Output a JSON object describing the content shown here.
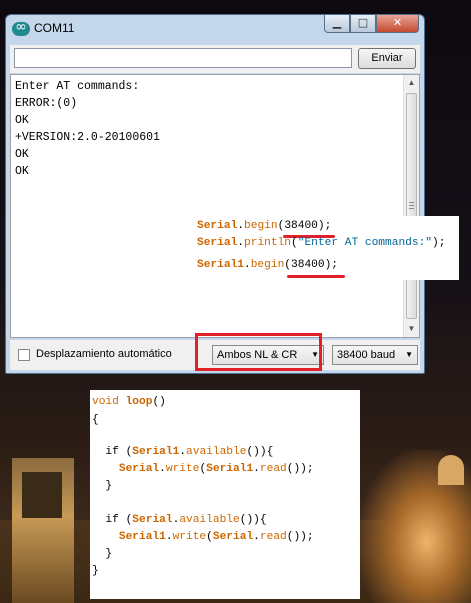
{
  "window": {
    "title": "COM11",
    "controls": {
      "minimize": "▁",
      "maximize": "□",
      "close": "✕"
    }
  },
  "input": {
    "value": "",
    "send_label": "Enviar"
  },
  "output_lines": [
    "Enter AT commands:",
    "ERROR:(0)",
    "OK",
    "+VERSION:2.0-20100601",
    "OK",
    "OK"
  ],
  "bottom": {
    "autoscroll_label": "Desplazamiento automático",
    "autoscroll_checked": false,
    "line_ending": "Ambos NL & CR",
    "baud": "38400 baud"
  },
  "snippet_setup": {
    "line1": {
      "obj": "Serial",
      "dot": ".",
      "method": "begin",
      "open": "(",
      "arg": "38400",
      "close": ");"
    },
    "line2": {
      "obj": "Serial",
      "dot": ".",
      "method": "println",
      "open": "(",
      "arg": "\"Enter AT commands:\"",
      "close": ");"
    },
    "line3": {
      "obj": "Serial1",
      "dot": ".",
      "method": "begin",
      "open": "(",
      "arg": "38400",
      "close": ");"
    }
  },
  "snippet_loop": {
    "l1": {
      "t1": "void ",
      "t2": "loop",
      "t3": "()"
    },
    "l2": "{",
    "l3": {
      "t1": "  if (",
      "t2": "Serial1",
      "t3": ".",
      "t4": "available",
      "t5": "()){"
    },
    "l4": {
      "t1": "    ",
      "t2": "Serial",
      "t3": ".",
      "t4": "write",
      "t5": "(",
      "t6": "Serial1",
      "t7": ".",
      "t8": "read",
      "t9": "());"
    },
    "l5": "  }",
    "l6": {
      "t1": "  if (",
      "t2": "Serial",
      "t3": ".",
      "t4": "available",
      "t5": "()){"
    },
    "l7": {
      "t1": "    ",
      "t2": "Serial1",
      "t3": ".",
      "t4": "write",
      "t5": "(",
      "t6": "Serial",
      "t7": ".",
      "t8": "read",
      "t9": "());"
    },
    "l8": "  }",
    "l9": "}"
  }
}
